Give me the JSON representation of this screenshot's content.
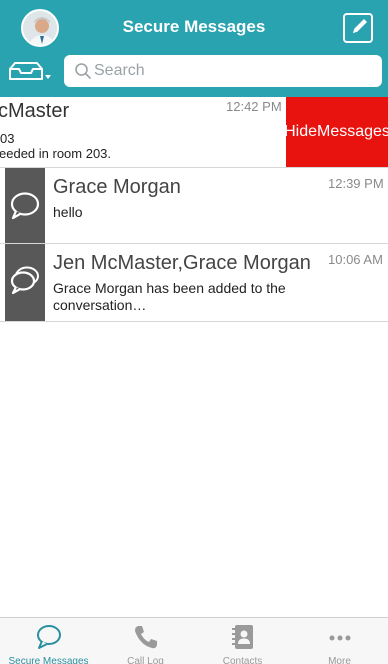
{
  "header": {
    "title": "Secure Messages"
  },
  "search": {
    "placeholder": "Search"
  },
  "conversations": [
    {
      "name": "cMaster",
      "time": "12:42 PM",
      "line1": "03",
      "line2": "eeded in room 203.",
      "swipe_action": "Hide Messages"
    },
    {
      "name": "Grace Morgan",
      "time": "12:39 PM",
      "preview": "hello",
      "icon": "chat-bubble-icon"
    },
    {
      "name": "Jen McMaster,Grace Morgan",
      "time": "10:06 AM",
      "preview": "Grace Morgan has been added to the conversation…",
      "icon": "group-chat-icon"
    }
  ],
  "tabs": [
    {
      "label": "Secure Messages",
      "icon": "chat-bubble-icon",
      "active": true
    },
    {
      "label": "Call Log",
      "icon": "phone-icon",
      "active": false
    },
    {
      "label": "Contacts",
      "icon": "contacts-book-icon",
      "active": false
    },
    {
      "label": "More",
      "icon": "more-dots-icon",
      "active": false
    }
  ],
  "colors": {
    "header": "#2aa3b0",
    "hide_action": "#e8130f",
    "chat_strip": "#585858",
    "active_tab": "#2a8fa0"
  }
}
